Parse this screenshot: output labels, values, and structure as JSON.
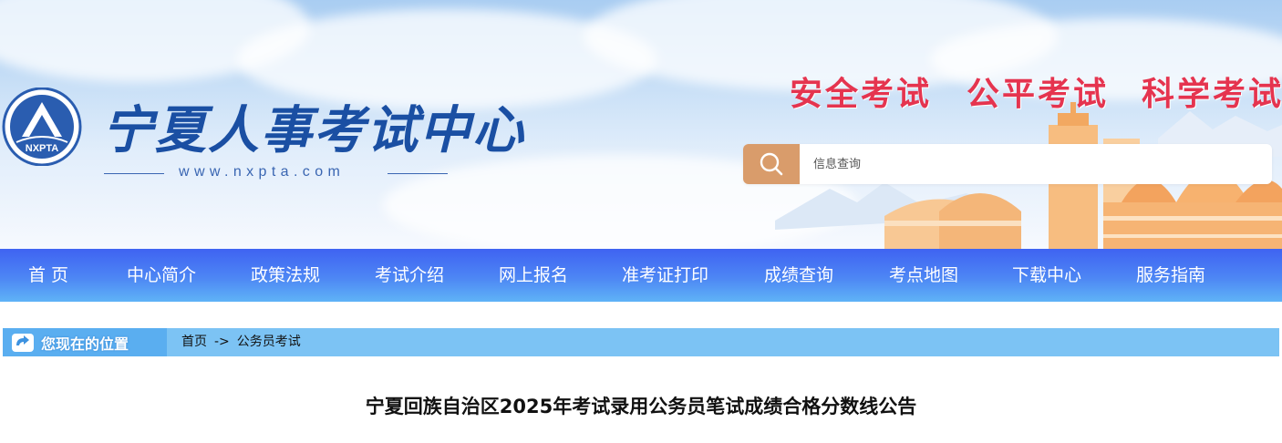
{
  "header": {
    "site_name": "宁夏人事考试中心",
    "logo_text": "NXPTA",
    "url": "www.nxpta.com",
    "slogans": [
      "安全考试",
      "公平考试",
      "科学考试"
    ],
    "colors": {
      "slogan": "#e5344f",
      "nav": "#4d86f4",
      "search_button": "#d99c6b",
      "site_name": "#1a4fa3"
    }
  },
  "search": {
    "placeholder": "信息查询",
    "button_icon": "search-icon"
  },
  "nav": {
    "items": [
      {
        "label": "首  页"
      },
      {
        "label": "中心简介"
      },
      {
        "label": "政策法规"
      },
      {
        "label": "考试介绍"
      },
      {
        "label": "网上报名"
      },
      {
        "label": "准考证打印"
      },
      {
        "label": "成绩查询"
      },
      {
        "label": "考点地图"
      },
      {
        "label": "下载中心"
      },
      {
        "label": "服务指南"
      }
    ]
  },
  "breadcrumb": {
    "label": "您现在的位置",
    "home": "首页",
    "separator": "->",
    "current": "公务员考试"
  },
  "article": {
    "title": "宁夏回族自治区2025年考试录用公务员笔试成绩合格分数线公告"
  }
}
